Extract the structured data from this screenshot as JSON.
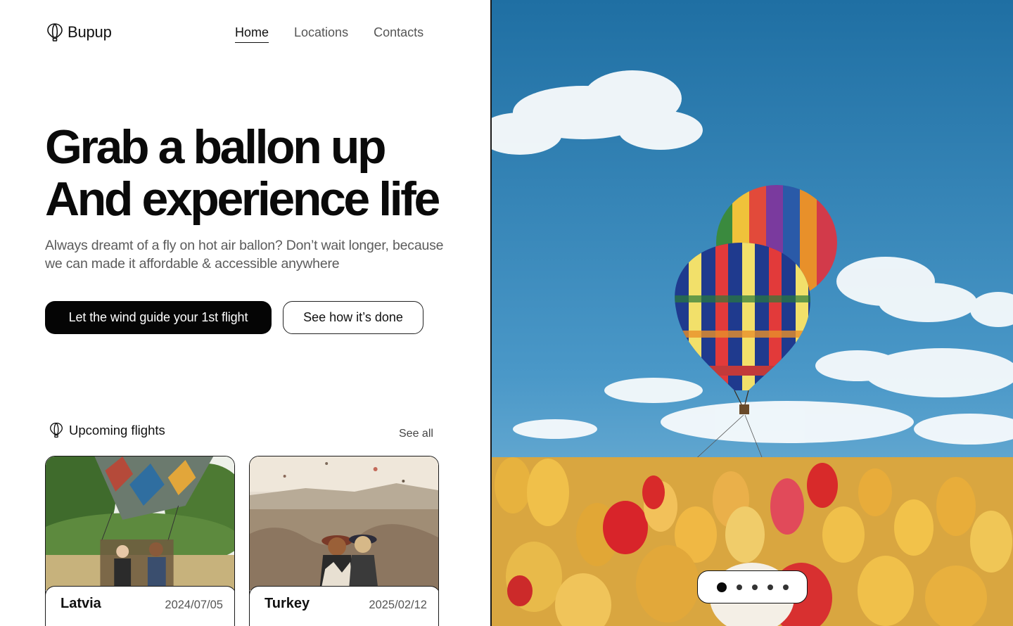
{
  "brand": {
    "name": "Bupup",
    "logo_icon": "balloon-icon"
  },
  "nav": {
    "items": [
      {
        "label": "Home",
        "active": true
      },
      {
        "label": "Locations",
        "active": false
      },
      {
        "label": "Contacts",
        "active": false
      }
    ]
  },
  "hero": {
    "title_line1": "Grab a ballon up",
    "title_line2": "And experience life",
    "subtitle": "Always dreamt of a fly on hot air ballon? Don’t wait longer, because we can made it affordable & accessible anywhere",
    "primary_cta": "Let the wind guide your 1st flight",
    "secondary_cta": "See how it’s done"
  },
  "upcoming": {
    "title": "Upcoming flights",
    "see_all": "See all",
    "flights": [
      {
        "location": "Latvia",
        "date": "2024/07/05"
      },
      {
        "location": "Turkey",
        "date": "2025/02/12"
      }
    ]
  },
  "carousel": {
    "slide_count": 5,
    "active_index": 0
  },
  "colors": {
    "primary": "#050505",
    "text_muted": "#5b5b5b",
    "sky": "#3a8bc0"
  }
}
